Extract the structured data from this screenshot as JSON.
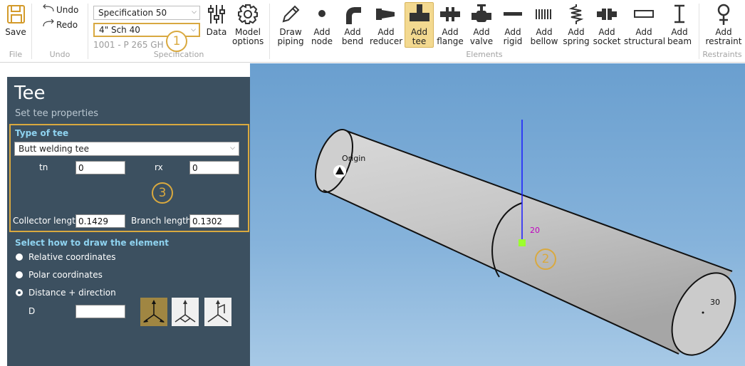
{
  "ribbon": {
    "file": {
      "save_label": "Save",
      "group_title": "File"
    },
    "undo": {
      "undo_label": "Undo",
      "redo_label": "Redo",
      "group_title": "Undo"
    },
    "specification": {
      "spec_value": "Specification 50",
      "size_value": "4\" Sch 40",
      "spec_code": "1001 - P 265 GH",
      "data_label": "Data",
      "model_options_line1": "Model",
      "model_options_line2": "options",
      "group_title": "Specification"
    },
    "elements": {
      "group_title": "Elements",
      "draw_piping": [
        "Draw",
        "piping"
      ],
      "add_node": [
        "Add",
        "node"
      ],
      "add_bend": [
        "Add",
        "bend"
      ],
      "add_reducer": [
        "Add",
        "reducer"
      ],
      "add_tee": [
        "Add",
        "tee"
      ],
      "add_flange": [
        "Add",
        "flange"
      ],
      "add_valve": [
        "Add",
        "valve"
      ],
      "add_rigid": [
        "Add",
        "rigid"
      ],
      "add_bellow": [
        "Add",
        "bellow"
      ],
      "add_spring": [
        "Add",
        "spring"
      ],
      "add_socket": [
        "Add",
        "socket"
      ],
      "add_structural": [
        "Add",
        "structural"
      ],
      "add_beam": [
        "Add",
        "beam"
      ]
    },
    "restraints": {
      "add_restraint": [
        "Add",
        "restraint"
      ],
      "group_title": "Restraints"
    }
  },
  "callouts": {
    "c1": "1",
    "c2": "2",
    "c3": "3"
  },
  "panel": {
    "title": "Tee",
    "subtitle": "Set tee properties",
    "type_heading": "Type of tee",
    "type_value": "Butt welding tee",
    "tn_label": "tn",
    "tn_value": "0",
    "rx_label": "rx",
    "rx_value": "0",
    "collector_label": "Collector length",
    "collector_value": "0.1429",
    "branch_label": "Branch length",
    "branch_value": "0.1302",
    "draw_heading": "Select how to draw the element",
    "options": [
      "Relative coordinates",
      "Polar coordinates",
      "Distance + direction"
    ],
    "selected_option": "Distance + direction",
    "d_label": "D",
    "d_value": ""
  },
  "viewport": {
    "origin_label": "Origin",
    "node_20": "20",
    "node_30": "30",
    "accent_color": "#d9a93f",
    "node_marker_color": "#9cff2e",
    "axis_color": "#1a1aff"
  }
}
